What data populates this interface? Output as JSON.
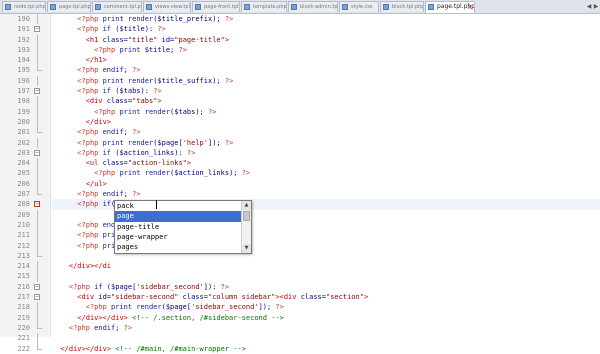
{
  "tabs": [
    {
      "label": "node.tpl.php",
      "active": false
    },
    {
      "label": "page.tpl.php",
      "active": false
    },
    {
      "label": "comment.tpl.php",
      "active": false
    },
    {
      "label": "views-view.tpl.php",
      "active": false
    },
    {
      "label": "page-front.tpl.php",
      "active": false
    },
    {
      "label": "template.php",
      "active": false
    },
    {
      "label": "block-admin.tpl.php",
      "active": false
    },
    {
      "label": "style.css",
      "active": false
    },
    {
      "label": "block.tpl.php",
      "active": false
    },
    {
      "label": "page.tpl.php",
      "active": true
    }
  ],
  "tab_close_glyph": "x",
  "line_numbers": [
    "190",
    "191",
    "192",
    "193",
    "194",
    "195",
    "196",
    "197",
    "198",
    "199",
    "200",
    "201",
    "202",
    "203",
    "204",
    "205",
    "206",
    "207",
    "208",
    "209",
    "210",
    "211",
    "212",
    "213",
    "214",
    "215",
    "216",
    "217",
    "218",
    "219",
    "220",
    "221",
    "222"
  ],
  "code_lines": [
    "      <?php print render($title_prefix); ?>",
    "      <?php if ($title): ?>",
    "        <h1 class=\"title\" id=\"page-title\">",
    "          <?php print $title; ?>",
    "        </h1>",
    "      <?php endif; ?>",
    "      <?php print render($title_suffix); ?>",
    "      <?php if ($tabs): ?>",
    "        <div class=\"tabs\">",
    "          <?php print render($tabs); ?>",
    "        </div>",
    "      <?php endif; ?>",
    "      <?php print render($page['help']); ?>",
    "      <?php if ($action_links): ?>",
    "        <ul class=\"action-links\">",
    "          <?php print render($action_links); ?>",
    "        </ul>",
    "      <?php endif; ?>",
    "      <?php if($page[ ?>",
    "",
    "      <?php end",
    "      <?php pri",
    "      <?php pri",
    "",
    "    </div></di",
    "",
    "    <?php if ($page['sidebar_second']): ?>",
    "      <div id=\"sidebar-second\" class=\"column sidebar\"><div class=\"section\">",
    "        <?php print render($page['sidebar_second']); ?>",
    "      </div></div> <!-- /.section, /#sidebar-second -->",
    "    <?php endif; ?>",
    "",
    "  </div></div> <!-- /#main, /#main-wrapper -->"
  ],
  "autocomplete": {
    "items": [
      "pack",
      "page",
      "page-title",
      "page-wrapper",
      "pages"
    ],
    "selected_index": 1,
    "scroll_up_glyph": "▲",
    "scroll_down_glyph": "▼"
  },
  "colors": {
    "tag": "#c0392b",
    "keyword": "#1a1aa6",
    "string": "#8b0000",
    "comment": "#007700",
    "selection": "#3a6fd0",
    "current_line": "#eef3fb"
  }
}
